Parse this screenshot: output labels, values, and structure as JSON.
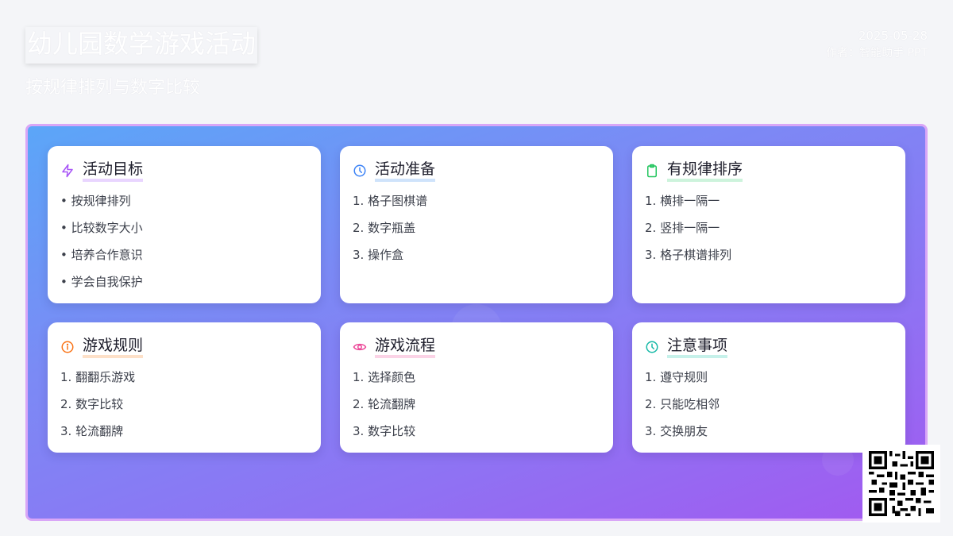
{
  "header": {
    "title": "幼儿园数学游戏活动",
    "subtitle": "按规律排列与数字比较",
    "date": "2025-05-28",
    "author": "作者：智能助手  PPT"
  },
  "colors": {
    "panel_border": "#d9a6f7",
    "gradient_start": "#5ba6f8",
    "gradient_end": "#a259f0",
    "purple": "#a855f7",
    "blue": "#3b82f6",
    "green": "#22c55e",
    "orange": "#f97316",
    "pink": "#ec4899",
    "teal": "#14b8a6"
  },
  "cards": [
    {
      "title": "活动目标",
      "icon": "lightning-icon",
      "items": [
        "• 按规律排列",
        "• 比较数字大小",
        "• 培养合作意识",
        "• 学会自我保护"
      ]
    },
    {
      "title": "活动准备",
      "icon": "clock-icon",
      "items": [
        "1. 格子图棋谱",
        "2. 数字瓶盖",
        "3. 操作盒"
      ]
    },
    {
      "title": "有规律排序",
      "icon": "clipboard-icon",
      "items": [
        "1. 横排一隔一",
        "2. 竖排一隔一",
        "3. 格子棋谱排列"
      ]
    },
    {
      "title": "游戏规则",
      "icon": "info-icon",
      "items": [
        "1. 翻翻乐游戏",
        "2. 数字比较",
        "3. 轮流翻牌"
      ]
    },
    {
      "title": "游戏流程",
      "icon": "eye-icon",
      "items": [
        "1. 选择颜色",
        "2. 轮流翻牌",
        "3. 数字比较"
      ]
    },
    {
      "title": "注意事项",
      "icon": "clock-icon",
      "items": [
        "1. 遵守规则",
        "2. 只能吃相邻",
        "3. 交换朋友"
      ]
    }
  ]
}
